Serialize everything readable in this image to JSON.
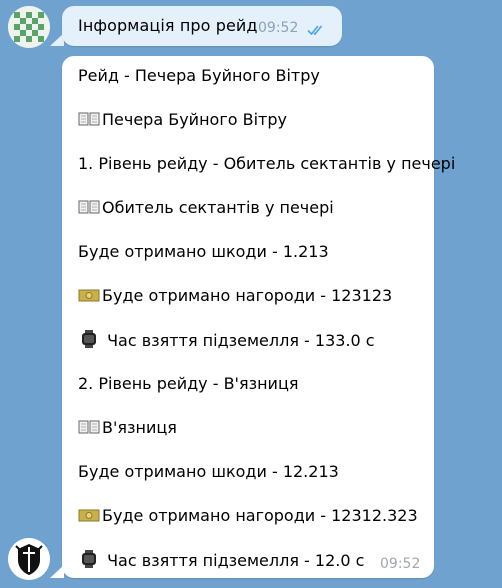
{
  "outgoing": {
    "text": "Інформація про рейд",
    "time": "09:52",
    "status": "read"
  },
  "incoming": {
    "time": "09:52",
    "lines": [
      {
        "icon": "",
        "text": "Рейд - Печера Буйного Вітру"
      },
      {
        "icon": "book-icon",
        "text": "Печера Буйного Вітру"
      },
      {
        "icon": "",
        "text": "1. Рівень рейду - Обитель сектантів у печері"
      },
      {
        "icon": "book-icon",
        "text": "Обитель сектантів у печері"
      },
      {
        "icon": "",
        "text": "Буде отримано шкоди - 1.213"
      },
      {
        "icon": "money-icon",
        "text": "Буде отримано нагороди - 123123"
      },
      {
        "icon": "watch-icon",
        "text": " Час взяття підземелля - 133.0 с"
      },
      {
        "icon": "",
        "text": "2. Рівень рейду - В'язниця"
      },
      {
        "icon": "book-icon",
        "text": "В'язниця"
      },
      {
        "icon": "",
        "text": "Буде отримано шкоди - 12.213"
      },
      {
        "icon": "money-icon",
        "text": "Буде отримано нагороди - 12312.323"
      },
      {
        "icon": "watch-icon",
        "text": " Час взяття підземелля - 12.0 с"
      }
    ]
  },
  "colors": {
    "background": "#6fa2cf",
    "outgoing_bubble": "#e4f1fb",
    "incoming_bubble": "#ffffff",
    "read_checks": "#4fa3e0"
  }
}
